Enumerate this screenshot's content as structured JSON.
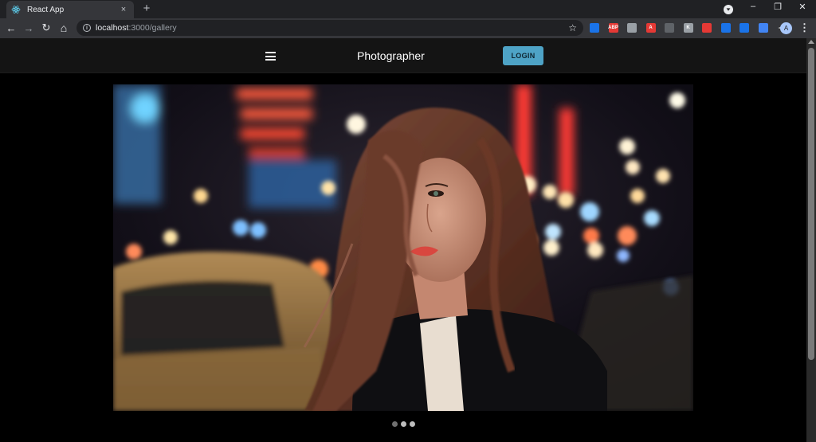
{
  "browser": {
    "tab": {
      "title": "React App",
      "favicon": "react-icon",
      "close": "×"
    },
    "new_tab": "+",
    "window": {
      "minimize": "–",
      "restore": "❐",
      "close": "✕"
    },
    "nav": {
      "back": "←",
      "forward": "→",
      "reload": "↻",
      "home": "⌂"
    },
    "url": {
      "host": "localhost",
      "path": ":3000/gallery"
    },
    "bookmark": "☆",
    "extensions": [
      {
        "name": "chrome-ext-icon",
        "color": "#1a73e8",
        "label": ""
      },
      {
        "name": "adblock-plus-icon",
        "color": "#e53935",
        "label": "ABP"
      },
      {
        "name": "extension-badge-icon",
        "color": "#9aa0a6",
        "label": ""
      },
      {
        "name": "red-a-extension-icon",
        "color": "#e53935",
        "label": "A"
      },
      {
        "name": "android-extension-icon",
        "color": "#5f6368",
        "label": ""
      },
      {
        "name": "k-extension-icon",
        "color": "#9aa0a6",
        "label": "K"
      },
      {
        "name": "red-square-extension-icon",
        "color": "#e53935",
        "label": ""
      },
      {
        "name": "blue-square-extension-icon",
        "color": "#1a73e8",
        "label": ""
      },
      {
        "name": "bookmark-extension-icon",
        "color": "#1a73e8",
        "label": ""
      },
      {
        "name": "link-extension-icon",
        "color": "#4285f4",
        "label": ""
      },
      {
        "name": "puzzle-extensions-icon",
        "color": "#e8eaed",
        "label": ""
      }
    ],
    "profile_initial": "A",
    "menu": "⋮"
  },
  "header": {
    "menu_icon": "hamburger-menu-icon",
    "brand": "Photographer",
    "login_label": "LOGIN"
  },
  "gallery": {
    "current_slide": 0,
    "slide_count": 3,
    "photo": "portrait-city-night-photo"
  },
  "colors": {
    "accent": "#4ea3c6",
    "header_bg": "#141414",
    "page_bg": "#000000"
  }
}
